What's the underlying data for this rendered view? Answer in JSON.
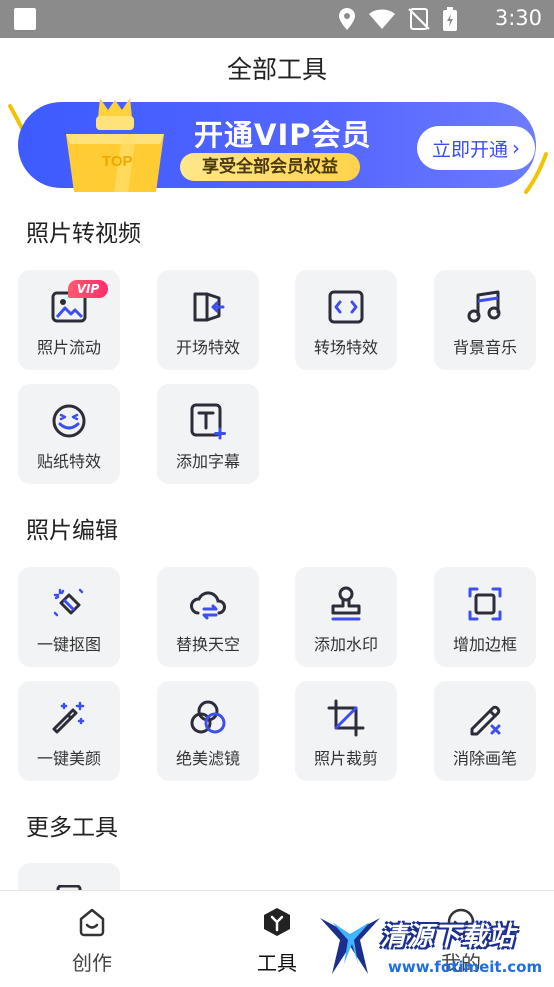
{
  "status_bar": {
    "time": "3:30"
  },
  "header": {
    "title": "全部工具"
  },
  "banner": {
    "crown_label": "TOP",
    "headline": "开通VIP会员",
    "subline": "享受全部会员权益",
    "cta": "立即开通",
    "chevron_glyph": "›"
  },
  "sections": [
    {
      "title": "照片转视频",
      "items": [
        {
          "label": "照片流动",
          "icon": "photo-icon",
          "badge": "VIP"
        },
        {
          "label": "开场特效",
          "icon": "opening-effect-icon"
        },
        {
          "label": "转场特效",
          "icon": "transition-icon"
        },
        {
          "label": "背景音乐",
          "icon": "music-note-icon"
        },
        {
          "label": "贴纸特效",
          "icon": "sticker-face-icon"
        },
        {
          "label": "添加字幕",
          "icon": "subtitle-icon"
        }
      ]
    },
    {
      "title": "照片编辑",
      "items": [
        {
          "label": "一键抠图",
          "icon": "cutout-eraser-icon"
        },
        {
          "label": "替换天空",
          "icon": "sky-cloud-icon"
        },
        {
          "label": "添加水印",
          "icon": "stamp-icon"
        },
        {
          "label": "增加边框",
          "icon": "frame-icon"
        },
        {
          "label": "一键美颜",
          "icon": "magic-wand-icon"
        },
        {
          "label": "绝美滤镜",
          "icon": "filter-circles-icon"
        },
        {
          "label": "照片裁剪",
          "icon": "crop-icon"
        },
        {
          "label": "消除画笔",
          "icon": "eraser-brush-icon"
        }
      ]
    },
    {
      "title": "更多工具",
      "items": []
    }
  ],
  "bottom_nav": [
    {
      "label": "创作",
      "icon": "create-icon"
    },
    {
      "label": "工具",
      "icon": "tools-icon",
      "active": true
    },
    {
      "label": "我的",
      "icon": "profile-icon"
    }
  ],
  "watermark": {
    "title": "清源下载站",
    "url": "www.fotimeit.com"
  },
  "colors": {
    "accent": "#3d4ff0",
    "vip_badge": "#ff3d6e",
    "tile_bg": "#f2f3f5",
    "banner_yellow": "#ffd24a"
  }
}
